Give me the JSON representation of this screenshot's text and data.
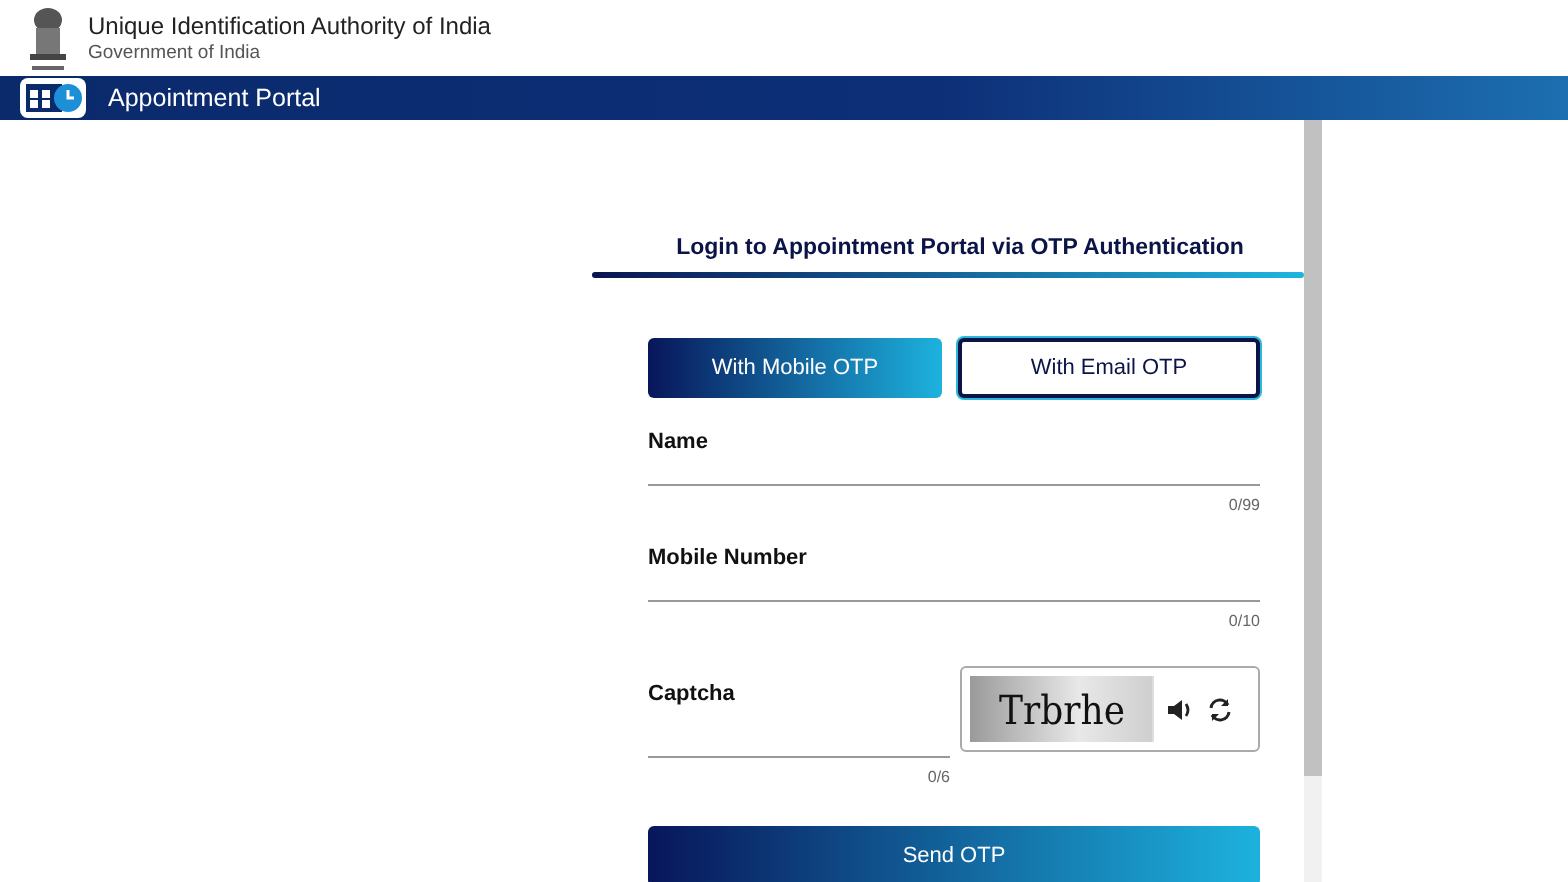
{
  "header": {
    "title": "Unique Identification Authority of India",
    "subtitle": "Government of India"
  },
  "nav_bar": {
    "title": "Appointment Portal"
  },
  "login": {
    "heading": "Login to Appointment Portal via OTP Authentication",
    "tabs": [
      {
        "label": "With Mobile OTP",
        "selected": true
      },
      {
        "label": "With Email OTP",
        "selected": false
      }
    ],
    "fields": [
      {
        "label": "Name",
        "counter": "0/99"
      },
      {
        "label": "Mobile Number",
        "counter": "0/10"
      }
    ],
    "captcha": {
      "label": "Captcha",
      "counter": "0/6",
      "image_text": "Trbrhe"
    },
    "submit": "Send OTP"
  }
}
